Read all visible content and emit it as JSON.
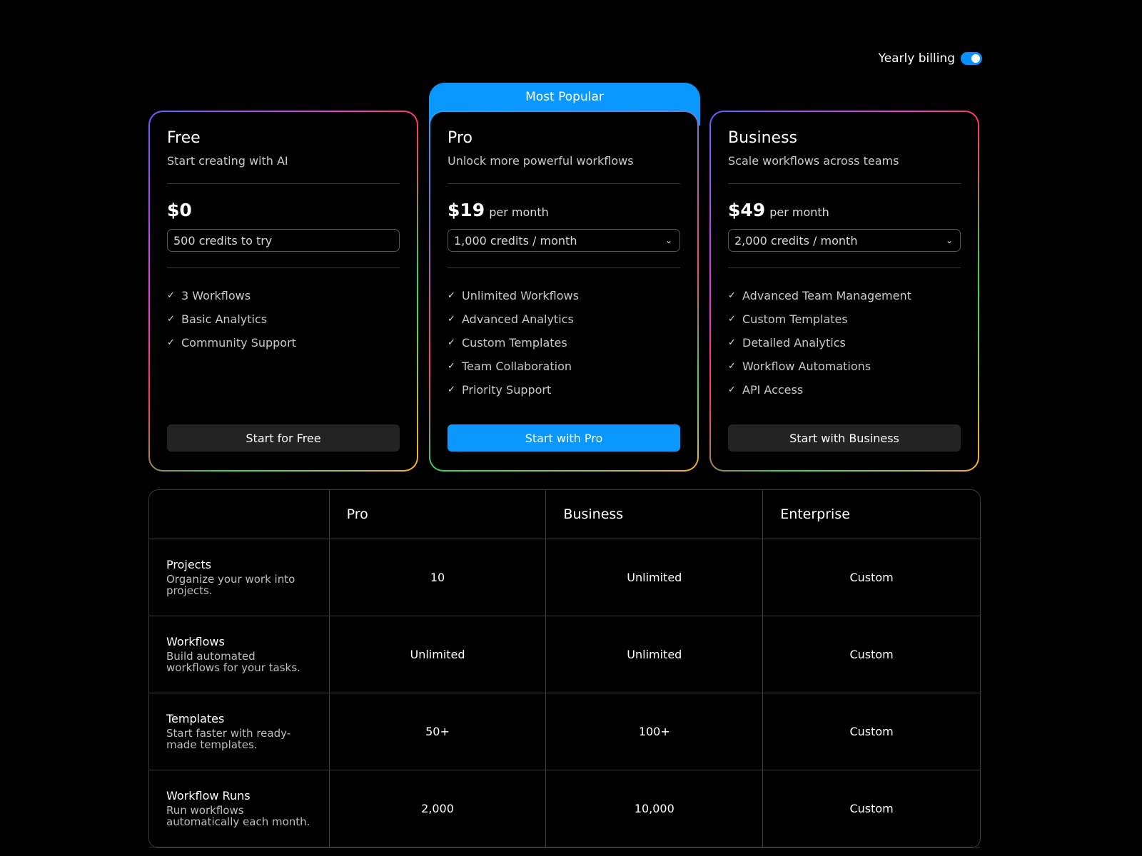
{
  "billing": {
    "label": "Yearly billing",
    "yearly_on": true
  },
  "badge": "Most Popular",
  "plans": [
    {
      "name": "Free",
      "description": "Start creating with AI",
      "price": "$0",
      "period": "",
      "credits": "500 credits to try",
      "features": [
        "3 Workflows",
        "Basic Analytics",
        "Community Support"
      ],
      "cta": "Start for Free"
    },
    {
      "name": "Pro",
      "description": "Unlock more powerful workflows",
      "price": "$19",
      "period": "per month",
      "credits": "1,000 credits / month",
      "features": [
        "Unlimited Workflows",
        "Advanced Analytics",
        "Custom Templates",
        "Team Collaboration",
        "Priority Support"
      ],
      "cta": "Start with Pro"
    },
    {
      "name": "Business",
      "description": "Scale workflows across teams",
      "price": "$49",
      "period": "per month",
      "credits": "2,000 credits / month",
      "features": [
        "Advanced Team Management",
        "Custom Templates",
        "Detailed Analytics",
        "Workflow Automations",
        "API Access"
      ],
      "cta": "Start with Business"
    }
  ],
  "comparison": {
    "headers": [
      "",
      "Pro",
      "Business",
      "Enterprise"
    ],
    "rows": [
      {
        "title": "Projects",
        "desc": "Organize your work into projects.",
        "values": [
          "10",
          "Unlimited",
          "Custom"
        ]
      },
      {
        "title": "Workflows",
        "desc": "Build automated workflows for your tasks.",
        "values": [
          "Unlimited",
          "Unlimited",
          "Custom"
        ]
      },
      {
        "title": "Templates",
        "desc": "Start faster with ready-made templates.",
        "values": [
          "50+",
          "100+",
          "Custom"
        ]
      },
      {
        "title": "Workflow Runs",
        "desc": "Run workflows automatically each month.",
        "values": [
          "2,000",
          "10,000",
          "Custom"
        ]
      }
    ]
  },
  "colors": {
    "accent": "#0a98ff",
    "background": "#000000",
    "button_dark": "#232323"
  }
}
